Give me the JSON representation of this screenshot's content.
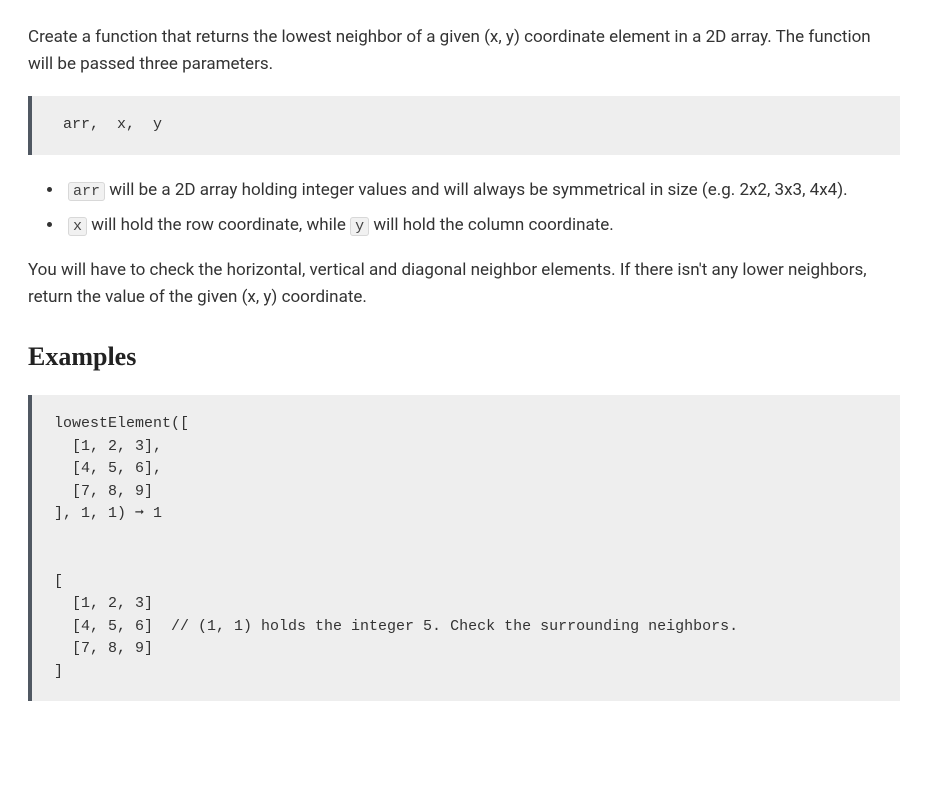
{
  "intro": {
    "para1_a": "Create a function that returns the lowest neighbor of a given (x, y) coordinate element in a 2D array. The function will be passed three parameters."
  },
  "code1": " arr,  x,  y",
  "bullets": {
    "b1_a": " will be a 2D array holding integer values and will always be symmetrical in size (e.g. 2x2, 3x3, 4x4).",
    "b2_a": " will hold the row coordinate, while ",
    "b2_b": " will hold the column coordinate.",
    "arr": "arr",
    "x": "x",
    "y": "y"
  },
  "para2": "You will have to check the horizontal, vertical and diagonal neighbor elements. If there isn't any lower neighbors, return the value of the given (x, y) coordinate.",
  "examples_heading": "Examples",
  "code2": "lowestElement([\n  [1, 2, 3],\n  [4, 5, 6],\n  [7, 8, 9]\n], 1, 1) ➞ 1\n\n\n[\n  [1, 2, 3]\n  [4, 5, 6]  // (1, 1) holds the integer 5. Check the surrounding neighbors.\n  [7, 8, 9]\n]"
}
